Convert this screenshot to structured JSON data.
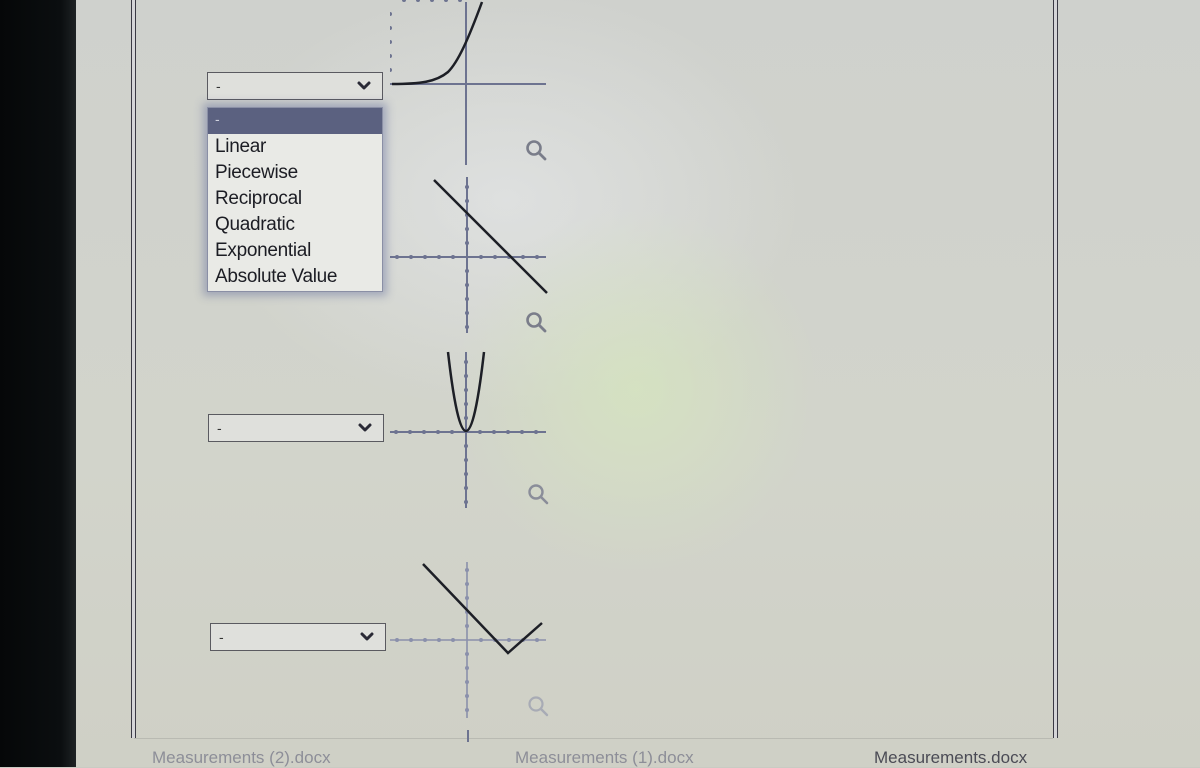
{
  "question": {
    "rows": [
      {
        "select_value": "-",
        "graph": "exponential",
        "dropdown_open": true
      },
      {
        "select_value": "-",
        "graph": "linear",
        "dropdown_open": false
      },
      {
        "select_value": "-",
        "graph": "quadratic",
        "dropdown_open": false
      },
      {
        "select_value": "-",
        "graph": "absolute-value",
        "dropdown_open": false
      }
    ],
    "dropdown": {
      "selected": "-",
      "options": [
        "-",
        "Linear",
        "Piecewise",
        "Reciprocal",
        "Quadratic",
        "Exponential",
        "Absolute Value"
      ]
    },
    "icons": {
      "zoom": "magnifier-icon",
      "chevron": "chevron-down-icon"
    }
  },
  "taskbar": {
    "items": [
      "Measurements (2).docx",
      "Measurements (1).docx",
      "Measurements.docx"
    ]
  },
  "colors": {
    "dropdown_highlight": "#5b6180",
    "graph_line": "#1d1f26",
    "axis": "#6d7390"
  }
}
